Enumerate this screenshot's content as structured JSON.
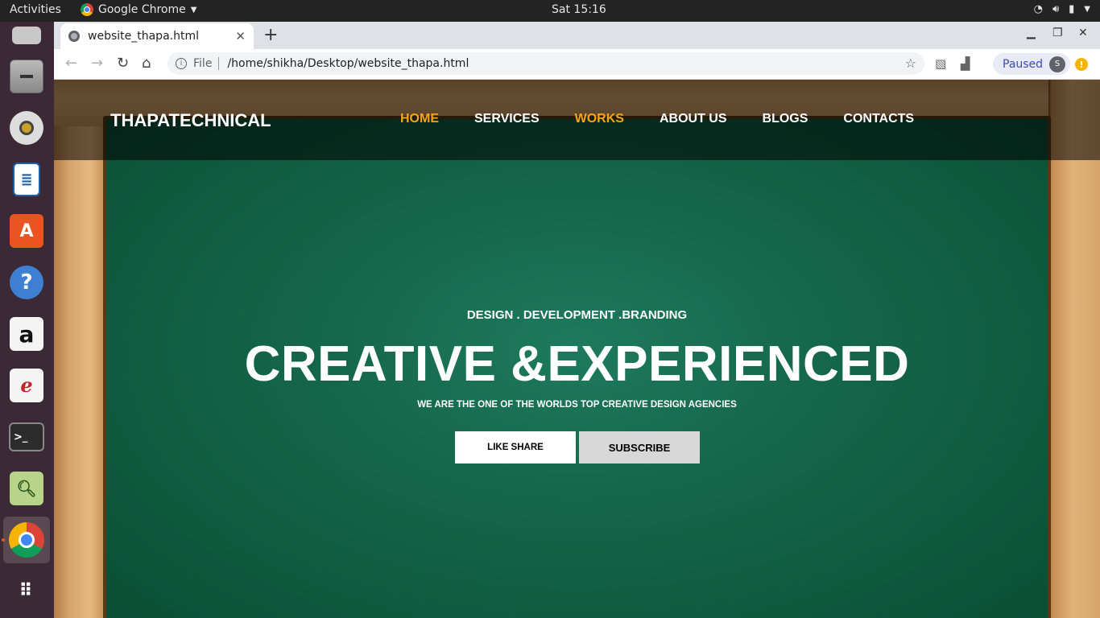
{
  "topbar": {
    "activities": "Activities",
    "app_name": "Google Chrome",
    "clock": "Sat 15:16"
  },
  "dock": {
    "items": [
      "thunderbird-icon",
      "files-icon",
      "rhythmbox-icon",
      "libreoffice-writer-icon",
      "software-center-icon",
      "help-icon",
      "amazon-icon",
      "document-viewer-icon",
      "terminal-icon",
      "image-viewer-icon",
      "chrome-icon",
      "app-grid-icon"
    ]
  },
  "browser": {
    "tab_title": "website_thapa.html",
    "address_scheme": "File",
    "address_url": "/home/shikha/Desktop/website_thapa.html",
    "profile_status": "Paused",
    "profile_initial": "S"
  },
  "site": {
    "brand": "THAPATECHNICAL",
    "nav": [
      {
        "label": "HOME",
        "highlight": true
      },
      {
        "label": "SERVICES",
        "highlight": false
      },
      {
        "label": "WORKS",
        "highlight": true
      },
      {
        "label": "ABOUT US",
        "highlight": false
      },
      {
        "label": "BLOGS",
        "highlight": false
      },
      {
        "label": "CONTACTS",
        "highlight": false
      }
    ],
    "hero": {
      "tagline": "DESIGN . DEVELOPMENT .BRANDING",
      "headline": "CREATIVE &EXPERIENCED",
      "subline": "WE ARE THE ONE OF THE WORLDS TOP CREATIVE DESIGN AGENCIES",
      "button_primary": "LIKE SHARE",
      "button_secondary": "SUBSCRIBE"
    },
    "colors": {
      "accent": "#f9a412",
      "board": "#15684c"
    }
  }
}
